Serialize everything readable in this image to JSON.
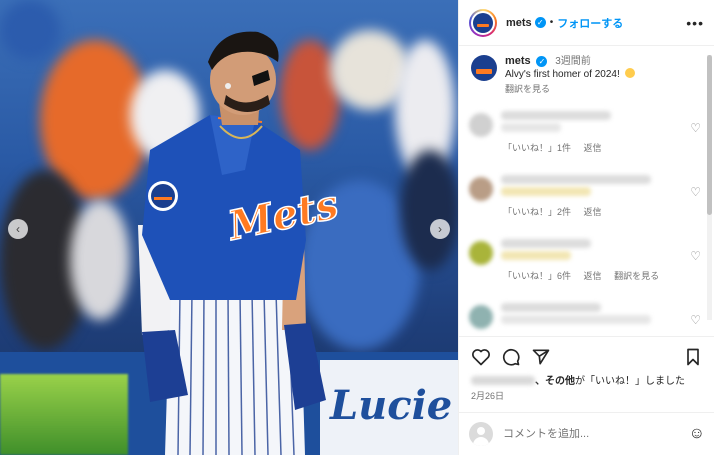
{
  "header": {
    "username": "mets",
    "separator": "•",
    "follow_label": "フォローする",
    "more_label": "•••"
  },
  "caption": {
    "username": "mets",
    "time": "3週間前",
    "text": "Alvy's first homer of 2024!",
    "emoji": "smiling-face-with-heart-eyes",
    "translate_label": "翻訳を見る"
  },
  "comments": [
    {
      "likes": "「いいね！」1件",
      "reply": "返信",
      "translate": ""
    },
    {
      "likes": "「いいね！」2件",
      "reply": "返信",
      "translate": ""
    },
    {
      "likes": "「いいね！」6件",
      "reply": "返信",
      "translate": "翻訳を見る"
    }
  ],
  "likes_line": {
    "suffix": "、その他",
    "middle": "が",
    "quote": "「いいね！」",
    "end": "しました"
  },
  "date": "2月26日",
  "comment_input": {
    "placeholder": "コメントを追加..."
  },
  "photo": {
    "jersey_text": "Mets",
    "sign_text": "Lucie"
  },
  "colors": {
    "accent": "#0095f6",
    "mets_blue": "#1b3f8f",
    "mets_orange": "#ff7a21"
  }
}
